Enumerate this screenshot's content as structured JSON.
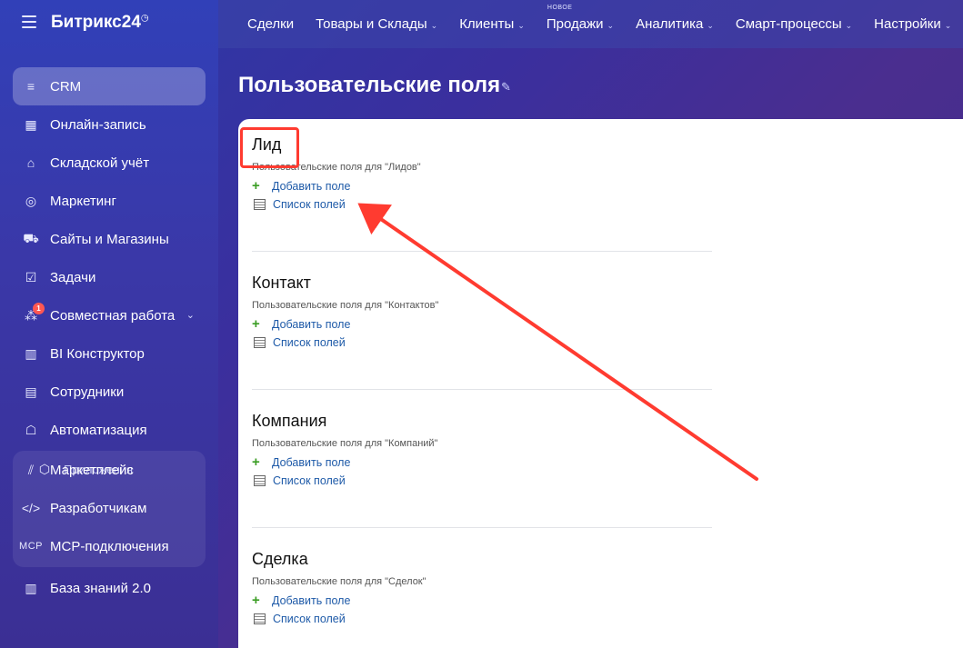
{
  "app": {
    "logo": "Битрикс24",
    "logo_mark": "◷"
  },
  "sidebar": {
    "items": [
      {
        "label": "CRM",
        "icon": "crm-filter-icon",
        "glyph": "≡"
      },
      {
        "label": "Онлайн-запись",
        "icon": "calendar-icon",
        "glyph": "▦"
      },
      {
        "label": "Складской учёт",
        "icon": "warehouse-icon",
        "glyph": "⌂"
      },
      {
        "label": "Маркетинг",
        "icon": "target-icon",
        "glyph": "◎"
      },
      {
        "label": "Сайты и Магазины",
        "icon": "cart-icon",
        "glyph": "⛟"
      },
      {
        "label": "Задачи",
        "icon": "checkbox-icon",
        "glyph": "☑"
      },
      {
        "label": "Совместная работа",
        "icon": "collab-icon",
        "glyph": "⁂",
        "badge": "1"
      },
      {
        "label": "BI Конструктор",
        "icon": "bar-chart-icon",
        "glyph": "▥"
      },
      {
        "label": "Сотрудники",
        "icon": "employee-card-icon",
        "glyph": "▤"
      },
      {
        "label": "Автоматизация",
        "icon": "robot-icon",
        "glyph": "☖"
      }
    ],
    "apps_section": "Приложения",
    "apps_items": [
      {
        "label": "Маркетплейс",
        "icon": "marketplace-icon",
        "glyph": "⫽"
      },
      {
        "label": "Разработчикам",
        "icon": "code-icon",
        "glyph": "</>"
      },
      {
        "label": "MCP-подключения",
        "icon": "mcp-icon",
        "glyph": "MCP"
      }
    ],
    "knowledge": {
      "label": "База знаний 2.0",
      "icon": "books-icon",
      "glyph": "▥"
    }
  },
  "topnav": {
    "items": [
      {
        "label": "Сделки"
      },
      {
        "label": "Товары и Склады"
      },
      {
        "label": "Клиенты"
      },
      {
        "label": "Продажи",
        "tag": "НОВОЕ"
      },
      {
        "label": "Аналитика"
      },
      {
        "label": "Смарт-процессы"
      },
      {
        "label": "Настройки"
      }
    ]
  },
  "page": {
    "title": "Пользовательские поля"
  },
  "sections": [
    {
      "title": "Лид",
      "subtitle": "Пользовательские поля для \"Лидов\"",
      "add": "Добавить поле",
      "list": "Список полей"
    },
    {
      "title": "Контакт",
      "subtitle": "Пользовательские поля для \"Контактов\"",
      "add": "Добавить поле",
      "list": "Список полей"
    },
    {
      "title": "Компания",
      "subtitle": "Пользовательские поля для \"Компаний\"",
      "add": "Добавить поле",
      "list": "Список полей"
    },
    {
      "title": "Сделка",
      "subtitle": "Пользовательские поля для \"Сделок\"",
      "add": "Добавить поле",
      "list": "Список полей"
    }
  ],
  "colors": {
    "highlight": "#ff3b30",
    "link": "#1e5aa8",
    "plus": "#3a9d23"
  }
}
